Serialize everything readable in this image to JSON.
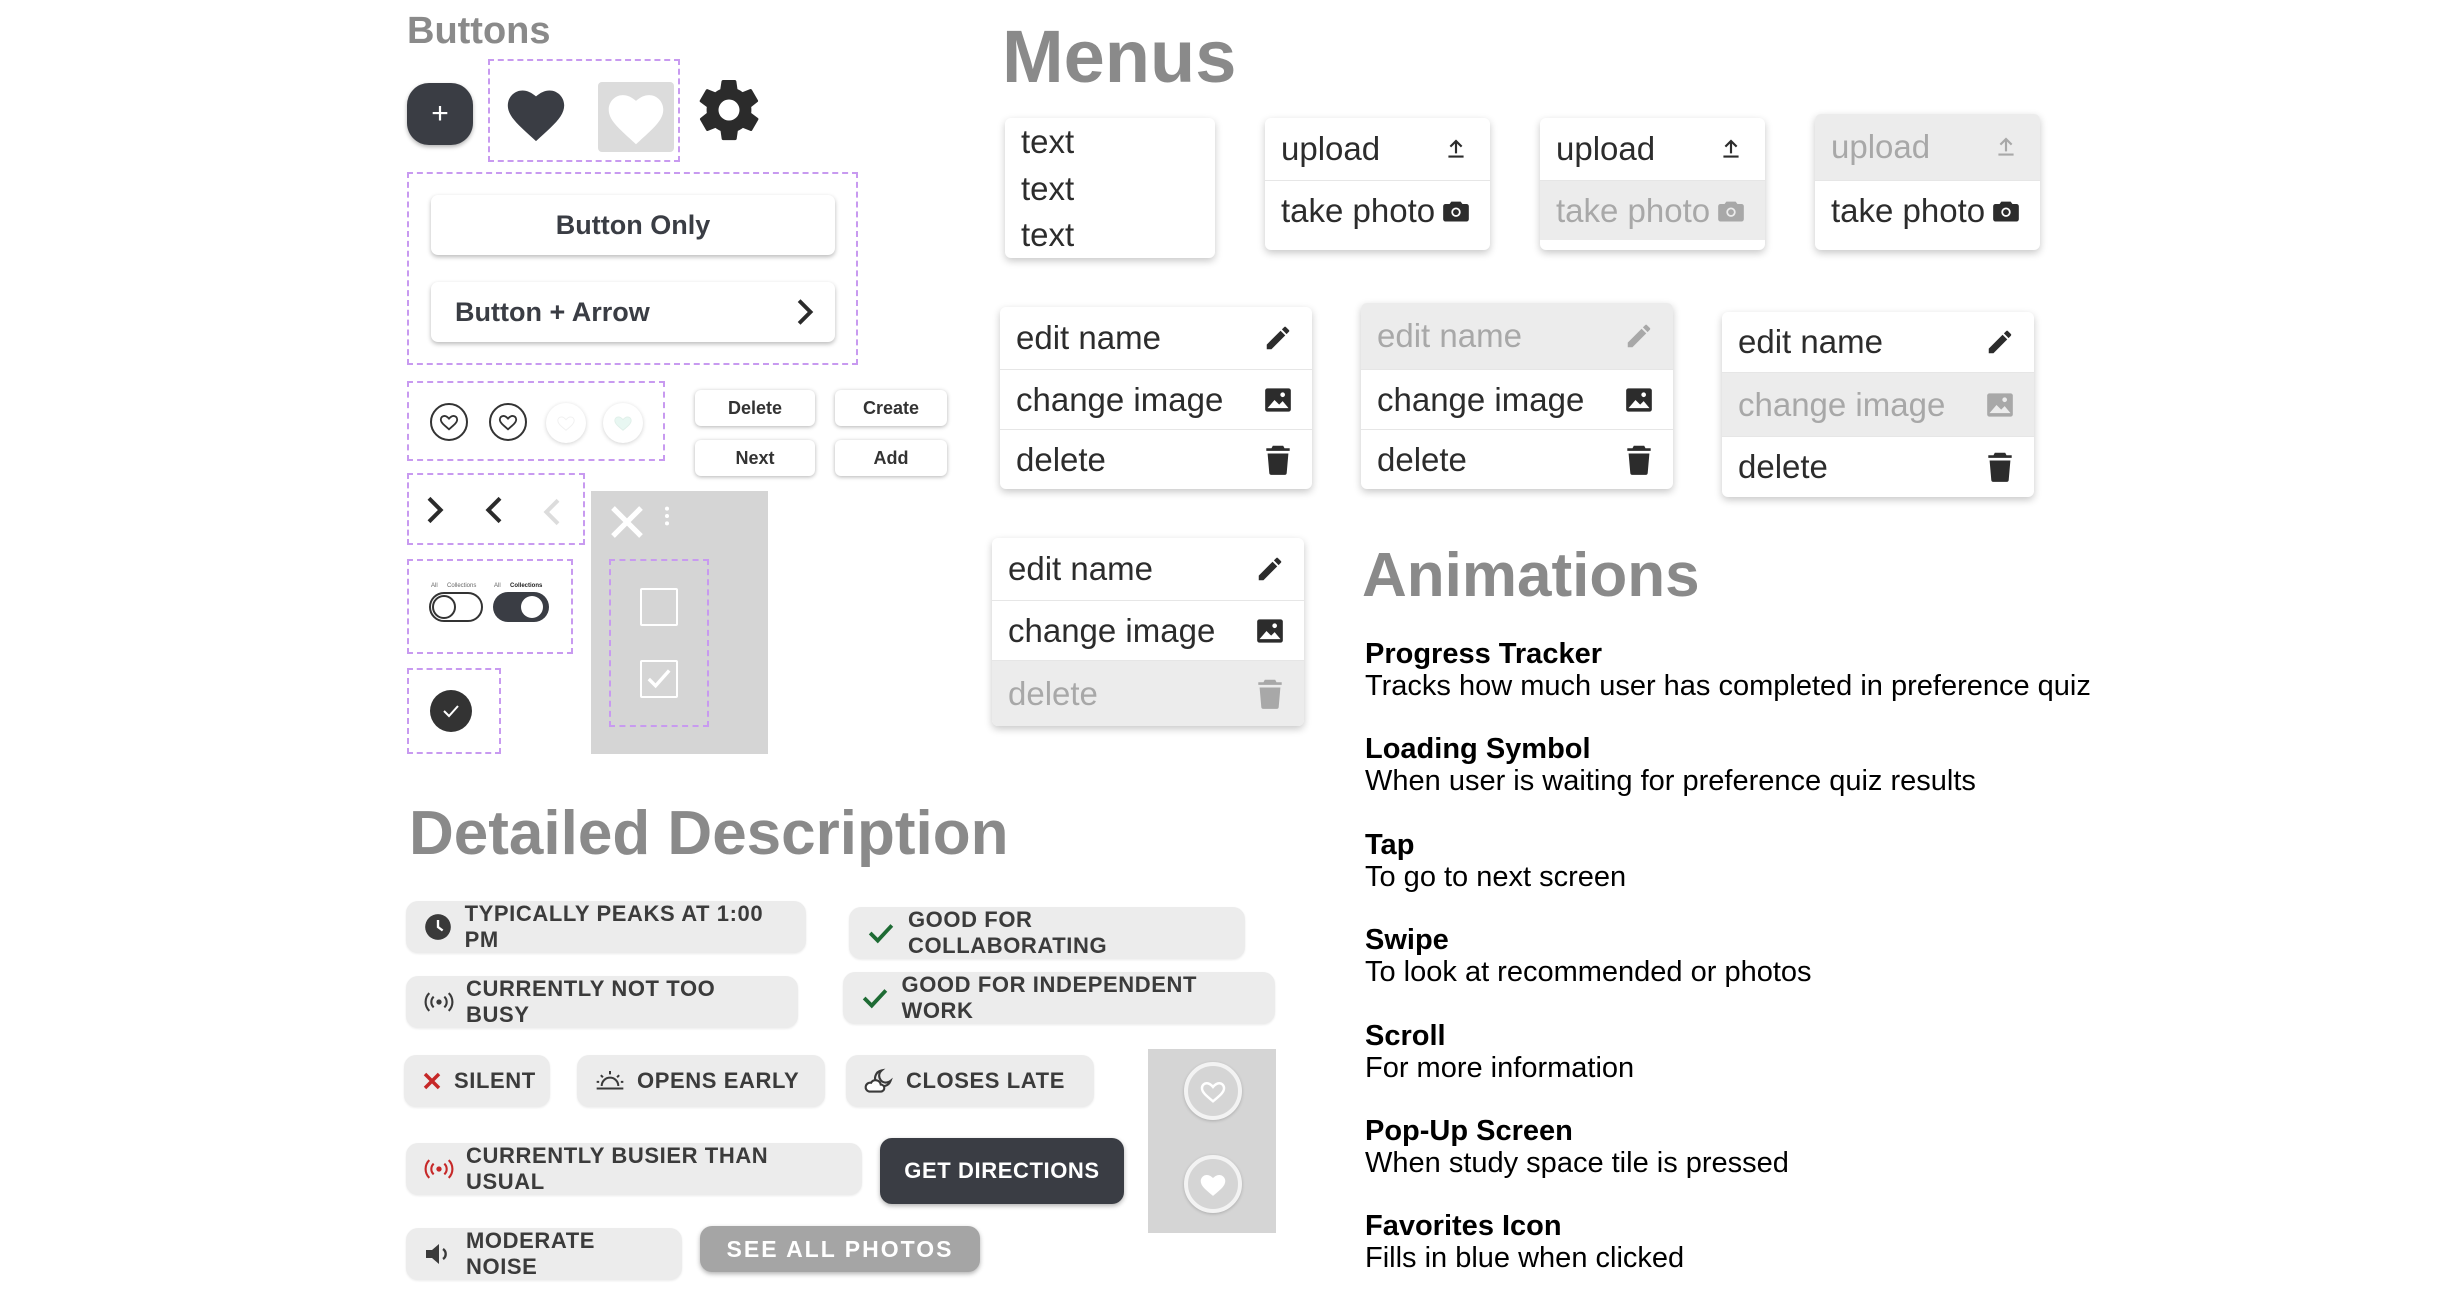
{
  "headings": {
    "buttons": "Buttons",
    "menus": "Menus",
    "animations": "Animations",
    "detailed": "Detailed Description"
  },
  "buttons": {
    "plus_label": "+",
    "button_only": "Button Only",
    "button_arrow": "Button + Arrow",
    "small": {
      "delete": "Delete",
      "create": "Create",
      "next": "Next",
      "add": "Add"
    },
    "toggle_labels": {
      "left": "All",
      "right": "Collections"
    },
    "icons": [
      "plus-icon",
      "heart-filled-icon",
      "heart-outline-icon",
      "gear-icon",
      "chevron-right-icon",
      "chevron-left-icon",
      "close-icon",
      "kebab-icon",
      "checkbox-icon",
      "check-circle-icon",
      "toggle-icon"
    ]
  },
  "menus": {
    "text_menu": [
      "text",
      "text",
      "text"
    ],
    "upload": "upload",
    "take_photo": "take photo",
    "edit_name": "edit name",
    "change_image": "change image",
    "delete": "delete"
  },
  "chips": {
    "peaks": "TYPICALLY PEAKS AT 1:00 PM",
    "collab": "GOOD FOR COLLABORATING",
    "not_busy": "CURRENTLY NOT TOO BUSY",
    "independent": "GOOD FOR INDEPENDENT WORK",
    "silent": "SILENT",
    "opens_early": "OPENS EARLY",
    "closes_late": "CLOSES LATE",
    "busier": "CURRENTLY BUSIER THAN USUAL",
    "directions": "GET DIRECTIONS",
    "moderate": "MODERATE NOISE",
    "photos": "SEE ALL PHOTOS"
  },
  "animations": [
    {
      "title": "Progress Tracker",
      "desc": "Tracks how much user has completed in preference quiz"
    },
    {
      "title": "Loading Symbol",
      "desc": "When user is waiting for preference quiz results"
    },
    {
      "title": "Tap",
      "desc": "To go to next screen"
    },
    {
      "title": "Swipe",
      "desc": "To look at recommended or photos"
    },
    {
      "title": "Scroll",
      "desc": "For more information"
    },
    {
      "title": "Pop-Up Screen",
      "desc": "When study space tile is pressed"
    },
    {
      "title": "Favorites Icon",
      "desc": "Fills in blue when clicked"
    }
  ],
  "colors": {
    "dark": "#3a3d44",
    "heading_gray": "#8a8a8a",
    "dash": "#c89af0",
    "red": "#c62828",
    "green": "#1e6b34",
    "panel": "#d5d5d5"
  }
}
